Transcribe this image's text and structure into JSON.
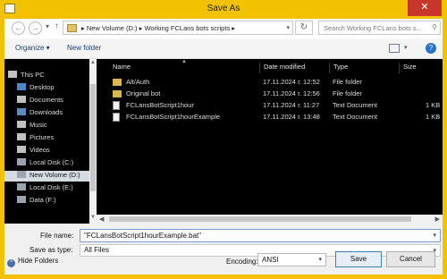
{
  "window": {
    "title": "Save As",
    "close_glyph": "✕"
  },
  "nav": {
    "back_glyph": "←",
    "forward_glyph": "→",
    "recent_glyph": "▾",
    "up_glyph": "↑",
    "address_crumbs": "▸  New Volume (D:)  ▸  Working FCLans bots scripts  ▸",
    "address_dropdown_glyph": "▾",
    "refresh_glyph": "↻",
    "search_placeholder": "Search Working FCLans bots s...",
    "search_glyph": "⚲"
  },
  "toolbar": {
    "organize_label": "Organize ▾",
    "new_folder_label": "New folder",
    "view_drop_glyph": "▾",
    "help_glyph": "?"
  },
  "sidebar": {
    "items": [
      {
        "label": "This PC"
      },
      {
        "label": "Desktop"
      },
      {
        "label": "Documents"
      },
      {
        "label": "Downloads"
      },
      {
        "label": "Music"
      },
      {
        "label": "Pictures"
      },
      {
        "label": "Videos"
      },
      {
        "label": "Local Disk (C:)"
      },
      {
        "label": "New Volume (D:)"
      },
      {
        "label": "Local Disk (E:)"
      },
      {
        "label": "Data (F:)"
      }
    ]
  },
  "filelist": {
    "columns": [
      "Name",
      "Date modified",
      "Type",
      "Size"
    ],
    "rows": [
      {
        "name": "Alt/Auth",
        "date": "17.11.2024 г. 12:52",
        "type": "File folder",
        "size": ""
      },
      {
        "name": "Original bot",
        "date": "17.11.2024 г. 12:56",
        "type": "File folder",
        "size": ""
      },
      {
        "name": "FCLansBotScript1hour",
        "date": "17.11.2024 г. 11:27",
        "type": "Text Document",
        "size": "1 KB"
      },
      {
        "name": "FCLansBotScript1hourExample",
        "date": "17.11.2024 г. 13:48",
        "type": "Text Document",
        "size": "1 KB"
      }
    ]
  },
  "form": {
    "filename_label": "File name:",
    "filename_value": "\"FCLansBotScript1hourExample.bat\"",
    "savetype_label": "Save as type:",
    "savetype_value": "All Files",
    "dropdown_glyph": "▾"
  },
  "footer": {
    "hide_folders_label": "Hide Folders",
    "hide_glyph": "^",
    "encoding_label": "Encoding:",
    "encoding_value": "ANSI",
    "save_label": "Save",
    "cancel_label": "Cancel"
  }
}
